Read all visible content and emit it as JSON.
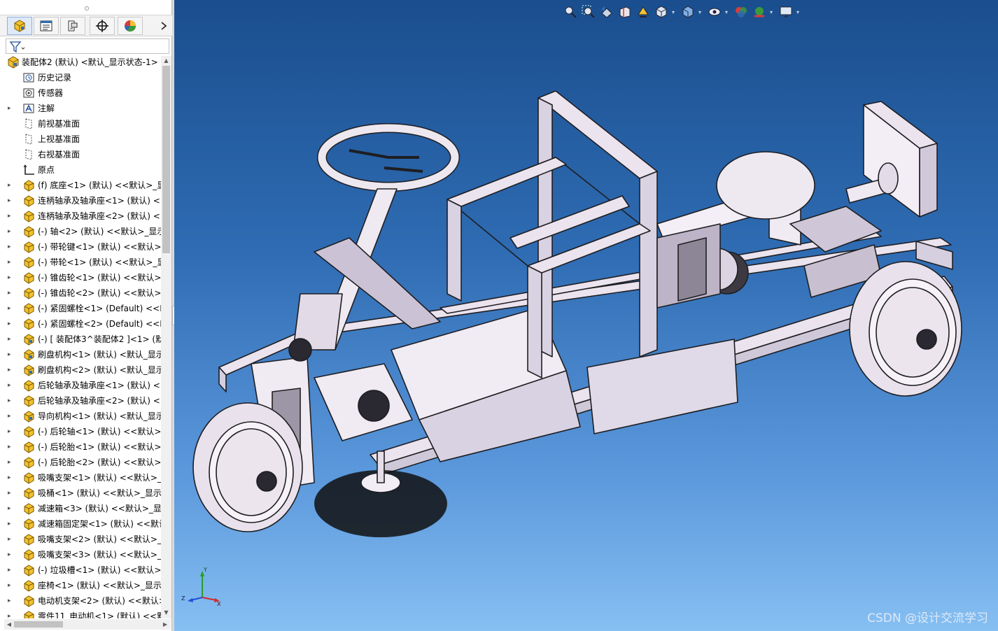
{
  "feature_tree": {
    "root_label": "装配体2 (默认) <默认_显示状态-1>",
    "items": [
      {
        "label": "历史记录",
        "icon": "history-folder-icon",
        "expandable": false
      },
      {
        "label": "传感器",
        "icon": "sensor-icon",
        "expandable": false
      },
      {
        "label": "注解",
        "icon": "annotation-icon",
        "expandable": true
      },
      {
        "label": "前视基准面",
        "icon": "plane-icon",
        "expandable": false
      },
      {
        "label": "上视基准面",
        "icon": "plane-icon",
        "expandable": false
      },
      {
        "label": "右视基准面",
        "icon": "plane-icon",
        "expandable": false
      },
      {
        "label": "原点",
        "icon": "origin-icon",
        "expandable": false
      },
      {
        "label": "(f) 底座<1> (默认) <<默认>_显",
        "icon": "part-icon",
        "expandable": true
      },
      {
        "label": "连柄轴承及轴承座<1> (默认) <<",
        "icon": "part-icon",
        "expandable": true
      },
      {
        "label": "连柄轴承及轴承座<2> (默认) <<",
        "icon": "part-icon",
        "expandable": true
      },
      {
        "label": "(-) 轴<2> (默认) <<默认>_显示",
        "icon": "part-icon",
        "expandable": true
      },
      {
        "label": "(-) 带轮键<1> (默认) <<默认>_",
        "icon": "part-icon",
        "expandable": true
      },
      {
        "label": "(-) 带轮<1> (默认) <<默认>_显",
        "icon": "part-icon",
        "expandable": true
      },
      {
        "label": "(-) 锥齿轮<1> (默认) <<默认>_",
        "icon": "part-icon",
        "expandable": true
      },
      {
        "label": "(-) 锥齿轮<2> (默认) <<默认>_",
        "icon": "part-icon",
        "expandable": true
      },
      {
        "label": "(-) 紧固螺栓<1> (Default) <<D",
        "icon": "part-icon",
        "expandable": true
      },
      {
        "label": "(-) 紧固螺栓<2> (Default) <<D",
        "icon": "part-icon",
        "expandable": true
      },
      {
        "label": "(-) [ 装配体3^装配体2 ]<1> (默",
        "icon": "assembly-icon",
        "expandable": true
      },
      {
        "label": "刷盘机构<1> (默认) <默认_显示",
        "icon": "assembly-icon",
        "expandable": true
      },
      {
        "label": "刷盘机构<2> (默认) <默认_显示",
        "icon": "assembly-icon",
        "expandable": true
      },
      {
        "label": "后轮轴承及轴承座<1> (默认) <<",
        "icon": "part-icon",
        "expandable": true
      },
      {
        "label": "后轮轴承及轴承座<2> (默认) <<",
        "icon": "part-icon",
        "expandable": true
      },
      {
        "label": "导向机构<1> (默认) <默认_显示",
        "icon": "assembly-icon",
        "expandable": true
      },
      {
        "label": "(-) 后轮轴<1> (默认) <<默认>_",
        "icon": "part-icon",
        "expandable": true
      },
      {
        "label": "(-) 后轮胎<1> (默认) <<默认>_",
        "icon": "part-icon",
        "expandable": true
      },
      {
        "label": "(-) 后轮胎<2> (默认) <<默认>_",
        "icon": "part-icon",
        "expandable": true
      },
      {
        "label": "吸嘴支架<1> (默认) <<默认>_显",
        "icon": "part-icon",
        "expandable": true
      },
      {
        "label": "吸桶<1> (默认) <<默认>_显示状",
        "icon": "part-icon",
        "expandable": true
      },
      {
        "label": "减速箱<3> (默认) <<默认>_显示",
        "icon": "part-icon",
        "expandable": true
      },
      {
        "label": "减速箱固定架<1> (默认) <<默认",
        "icon": "part-icon",
        "expandable": true
      },
      {
        "label": "吸嘴支架<2> (默认) <<默认>_显",
        "icon": "part-icon",
        "expandable": true
      },
      {
        "label": "吸嘴支架<3> (默认) <<默认>_显",
        "icon": "part-icon",
        "expandable": true
      },
      {
        "label": "(-) 垃圾槽<1> (默认) <<默认>_",
        "icon": "part-icon",
        "expandable": true
      },
      {
        "label": "座椅<1> (默认) <<默认>_显示状",
        "icon": "part-icon",
        "expandable": true
      },
      {
        "label": "电动机支架<2> (默认) <<默认>_",
        "icon": "part-icon",
        "expandable": true
      },
      {
        "label": "零件11_电动机<1> (默认) <<默",
        "icon": "part-icon",
        "expandable": true
      }
    ]
  },
  "panel_tabs": [
    {
      "name": "feature-manager",
      "icon": "feature-manager-tab-icon"
    },
    {
      "name": "property-manager",
      "icon": "property-manager-tab-icon"
    },
    {
      "name": "configuration-manager",
      "icon": "configuration-manager-tab-icon"
    },
    {
      "name": "dimxpert-manager",
      "icon": "dimxpert-tab-icon"
    },
    {
      "name": "display-manager",
      "icon": "display-manager-tab-icon"
    }
  ],
  "view_toolbar": [
    "zoom-to-fit-icon",
    "zoom-to-area-icon",
    "previous-view-icon",
    "section-view-icon",
    "dynamic-annotation-icon",
    "view-orientation-icon",
    "display-style-icon",
    "hide-show-items-icon",
    "edit-appearance-icon",
    "apply-scene-icon",
    "view-settings-icon"
  ],
  "triad_labels": {
    "x": "X",
    "y": "Y",
    "z": "Z"
  },
  "watermark": "CSDN @设计交流学习",
  "colors": {
    "viewport_top": "#1a4e8e",
    "viewport_bottom": "#86bff2",
    "part_fill": "#e8e0ec",
    "part_edge": "#222222",
    "part_icon": "#f2c230"
  }
}
